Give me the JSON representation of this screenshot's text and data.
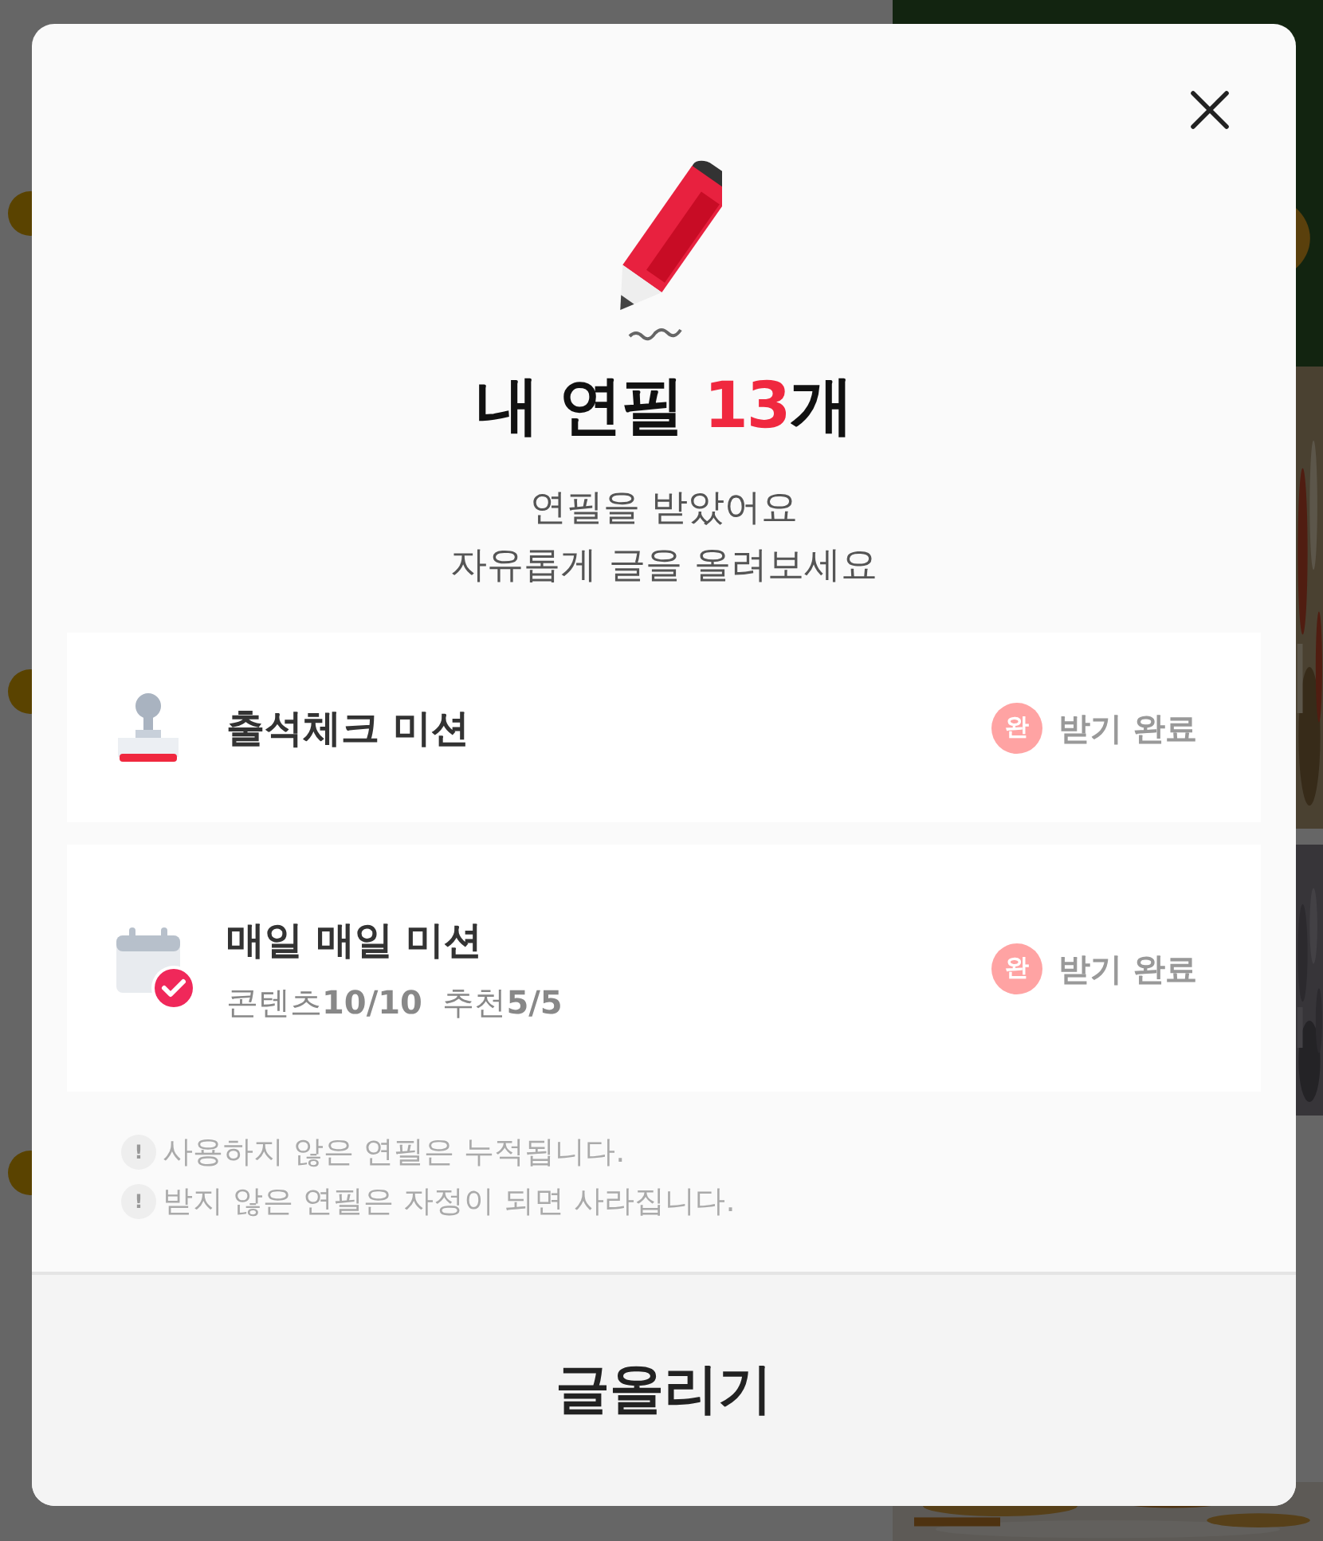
{
  "dialog": {
    "title_prefix": "내 연필 ",
    "count": "13",
    "title_suffix": "개",
    "subtitle": [
      "연필을 받았어요",
      "자유롭게 글을 올려보세요"
    ],
    "missions": [
      {
        "kind": "stamp",
        "title": "출석체크 미션",
        "badge": "완",
        "status": "받기 완료",
        "completed": true
      },
      {
        "kind": "calendar",
        "title": "매일 매일 미션",
        "detail": "콘텐츠**10/10**  추천**5/5**",
        "badge": "완",
        "status": "받기 완료",
        "completed": true
      }
    ],
    "notes": [
      {
        "mark": "!",
        "text": "사용하지 않은 연필은 누적됩니다."
      },
      {
        "mark": "!",
        "text": "받지 않은 연필은 자정이 되면 사라집니다."
      }
    ],
    "button": "글올리기"
  }
}
